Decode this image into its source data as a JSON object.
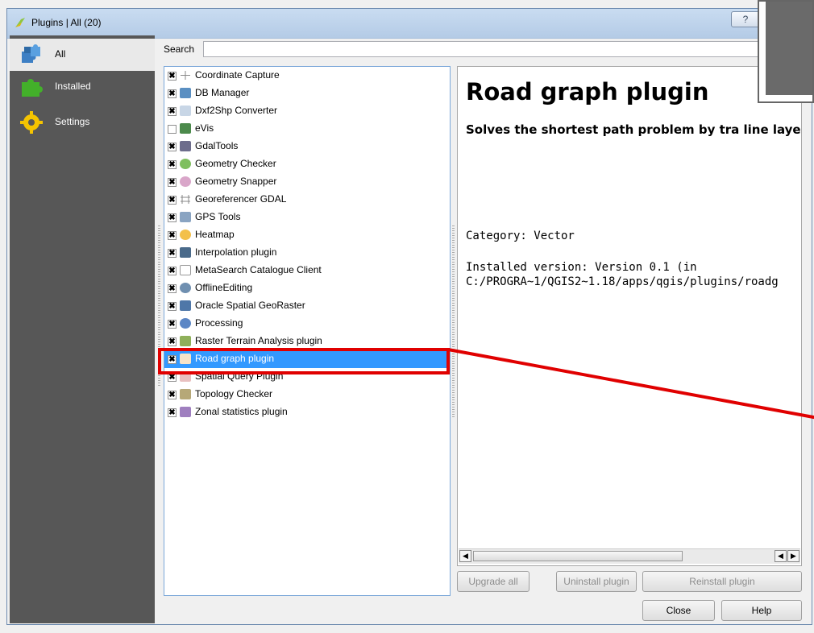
{
  "window": {
    "title": "Plugins | All (20)",
    "help_label": "?"
  },
  "sidebar": {
    "items": [
      {
        "label": "All",
        "icon": "all-puzzle-icon"
      },
      {
        "label": "Installed",
        "icon": "installed-puzzle-icon"
      },
      {
        "label": "Settings",
        "icon": "settings-gear-icon"
      }
    ]
  },
  "search": {
    "label": "Search",
    "value": ""
  },
  "plugins": [
    {
      "label": "Coordinate Capture",
      "checked": true
    },
    {
      "label": "DB Manager",
      "checked": true
    },
    {
      "label": "Dxf2Shp Converter",
      "checked": true
    },
    {
      "label": "eVis",
      "checked": false
    },
    {
      "label": "GdalTools",
      "checked": true
    },
    {
      "label": "Geometry Checker",
      "checked": true
    },
    {
      "label": "Geometry Snapper",
      "checked": true
    },
    {
      "label": "Georeferencer GDAL",
      "checked": true
    },
    {
      "label": "GPS Tools",
      "checked": true
    },
    {
      "label": "Heatmap",
      "checked": true
    },
    {
      "label": "Interpolation plugin",
      "checked": true
    },
    {
      "label": "MetaSearch Catalogue Client",
      "checked": true
    },
    {
      "label": "OfflineEditing",
      "checked": true
    },
    {
      "label": "Oracle Spatial GeoRaster",
      "checked": true
    },
    {
      "label": "Processing",
      "checked": true
    },
    {
      "label": "Raster Terrain Analysis plugin",
      "checked": true
    },
    {
      "label": "Road graph plugin",
      "checked": true,
      "selected": true
    },
    {
      "label": "Spatial Query Plugin",
      "checked": true
    },
    {
      "label": "Topology Checker",
      "checked": true
    },
    {
      "label": "Zonal statistics plugin",
      "checked": true
    }
  ],
  "details": {
    "title": "Road graph plugin",
    "description": "Solves the shortest path problem by tra line layers.",
    "category": "Category: Vector",
    "installed_version": "Installed version: Version 0.1 (in\nC:/PROGRA~1/QGIS2~1.18/apps/qgis/plugins/roadg"
  },
  "buttons": {
    "upgrade_all": "Upgrade all",
    "uninstall": "Uninstall plugin",
    "reinstall": "Reinstall plugin",
    "close": "Close",
    "help": "Help"
  },
  "colors": {
    "selection": "#3399ff",
    "annotation": "#e00000",
    "sidebar": "#575757"
  }
}
